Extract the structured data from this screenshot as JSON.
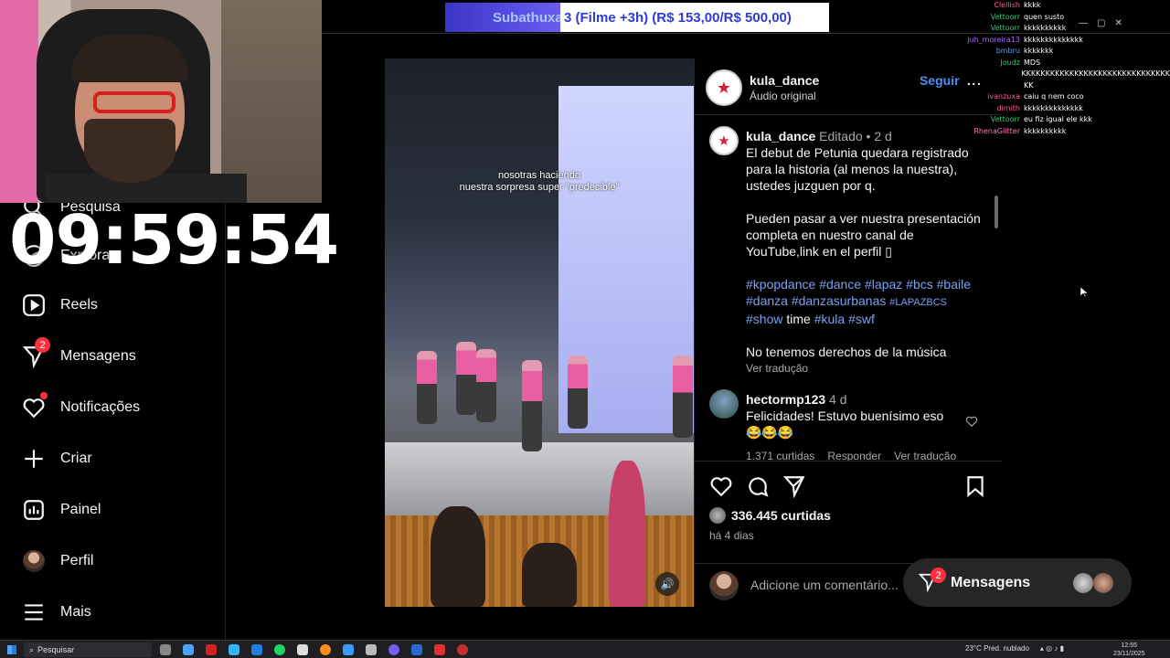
{
  "alert": {
    "name": "Subathuxa",
    "message": "3 (Filme +3h) (R$ 153,00/R$ 500,00)"
  },
  "timer": "09:59:54",
  "sidebar": {
    "items": [
      {
        "label": "Pesquisa",
        "icon": "search-icon"
      },
      {
        "label": "Explorar",
        "icon": "compass-icon"
      },
      {
        "label": "Reels",
        "icon": "reels-icon"
      },
      {
        "label": "Mensagens",
        "icon": "messenger-icon",
        "badge": "2"
      },
      {
        "label": "Notificações",
        "icon": "heart-icon"
      },
      {
        "label": "Criar",
        "icon": "plus-icon"
      },
      {
        "label": "Painel",
        "icon": "dashboard-icon"
      },
      {
        "label": "Perfil",
        "icon": "avatar"
      },
      {
        "label": "Mais",
        "icon": "menu-icon"
      }
    ]
  },
  "video": {
    "caption_line1": "nosotras haciendo",
    "caption_line2": "nuestra sorpresa super \"predecible\""
  },
  "post": {
    "username": "kula_dance",
    "audio": "Áudio original",
    "follow": "Seguir",
    "more": "...",
    "caption_username": "kula_dance",
    "edited": "Editado •",
    "age": "2 d",
    "caption_p1": "El debut de Petunia quedara registrado para la historia (al menos la nuestra), ustedes juzguen por q.",
    "caption_p2": "Pueden pasar a ver nuestra presentación completa en nuestro canal de YouTube,link en el perfil ▯",
    "hashtags": [
      "#kpopdance",
      "#dance",
      "#lapaz",
      "#bcs",
      "#baile",
      "#danza",
      "#danzasurbanas",
      "#LAPAZBCS",
      "#show",
      "time",
      "#kula",
      "#swf"
    ],
    "caption_p3": "No tenemos derechos de la música",
    "see_translation": "Ver tradução",
    "comment": {
      "username": "hectormp123",
      "age": "4 d",
      "text": "Felicidades! Estuvo buenísimo eso",
      "emojis": "😂😂😂",
      "likes": "1.371 curtidas",
      "reply": "Responder",
      "translate": "Ver tradução"
    },
    "likes": "336.445 curtidas",
    "when": "há 4 dias",
    "comment_placeholder": "Adicione um comentário..."
  },
  "messages_pill": {
    "label": "Mensagens",
    "badge": "2"
  },
  "chat": [
    {
      "nick": "Clellish",
      "color": "#ff5b8a",
      "text": "kkkk"
    },
    {
      "nick": "Vettoorr",
      "color": "#2ecc71",
      "text": "quen susto"
    },
    {
      "nick": "Vettoorr",
      "color": "#2ecc71",
      "text": "kkkkkkkkkk"
    },
    {
      "nick": "juh_moreira13",
      "color": "#b26bff",
      "text": "kkkkkkkkkkkkkk"
    },
    {
      "nick": "bmbru",
      "color": "#4aa3ff",
      "text": "kkkkkkk"
    },
    {
      "nick": "Joudz",
      "color": "#2ecc71",
      "text": "MDS"
    },
    {
      "nick": "",
      "color": "#ffffff",
      "text": "KKKKKKKKKKKKKKKKKKKKKKKKKKKKKKK"
    },
    {
      "nick": "",
      "color": "#ffffff",
      "text": "KK"
    },
    {
      "nick": "ivanzuxa",
      "color": "#ff5b8a",
      "text": "caiu q nem coco"
    },
    {
      "nick": "dimith",
      "color": "#ff5b8a",
      "text": "kkkkkkkkkkkkkk"
    },
    {
      "nick": "Vettoorr",
      "color": "#2ecc71",
      "text": "eu fiz igual ele kkk"
    },
    {
      "nick": "RhenaGlitter",
      "color": "#ff7ab8",
      "text": "kkkkkkkkkk"
    }
  ],
  "taskbar": {
    "search": "Pesquisar",
    "weather": "23°C  Pred. nublado",
    "time": "12:55",
    "date": "23/11/2025"
  },
  "colors": {
    "accent": "#4a8ff0",
    "notification": "#ff3040",
    "background": "#000000"
  }
}
